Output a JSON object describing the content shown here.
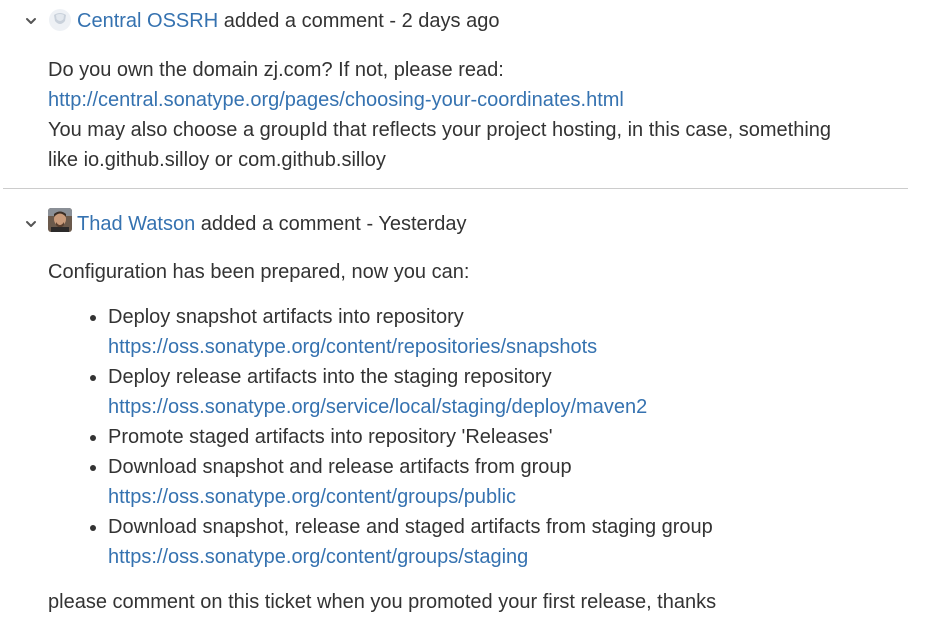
{
  "comments": [
    {
      "author": "Central OSSRH",
      "action": "added a comment",
      "separator": "-",
      "time": "2 days ago",
      "body": {
        "line1": "Do you own the domain zj.com? If not, please read:",
        "link": "http://central.sonatype.org/pages/choosing-your-coordinates.html",
        "line3": "You may also choose a groupId that reflects your project hosting, in this case, something",
        "line4": "like io.github.silloy or com.github.silloy"
      }
    },
    {
      "author": "Thad Watson",
      "action": "added a comment",
      "separator": "-",
      "time": "Yesterday",
      "body": {
        "intro": "Configuration has been prepared, now you can:",
        "items": [
          {
            "text": "Deploy snapshot artifacts into repository",
            "link": "https://oss.sonatype.org/content/repositories/snapshots"
          },
          {
            "text": "Deploy release artifacts into the staging repository",
            "link": "https://oss.sonatype.org/service/local/staging/deploy/maven2"
          },
          {
            "text": "Promote staged artifacts into repository 'Releases'",
            "link": ""
          },
          {
            "text": "Download snapshot and release artifacts from group",
            "link": "https://oss.sonatype.org/content/groups/public"
          },
          {
            "text": "Download snapshot, release and staged artifacts from staging group",
            "link": "https://oss.sonatype.org/content/groups/staging"
          }
        ],
        "outro": "please comment on this ticket when you promoted your first release, thanks"
      }
    }
  ],
  "icons": {
    "toggle": "chevron-down-icon",
    "avatar_default": "default-avatar-icon",
    "avatar_user": "user-photo-avatar"
  },
  "colors": {
    "link": "#3572b0",
    "text": "#333333",
    "divider": "#cccccc"
  }
}
